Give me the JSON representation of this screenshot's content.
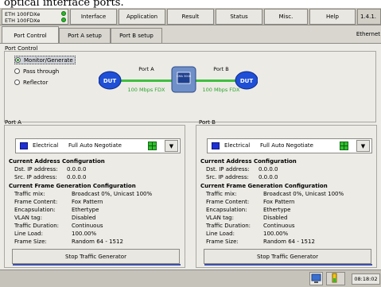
{
  "caption": "optical interface ports.",
  "module": {
    "line1": "ETH 100FDXe",
    "line2": "ETH 100FDXe"
  },
  "menu": [
    "Interface",
    "Application",
    "Result",
    "Status",
    "Misc.",
    "Help"
  ],
  "version": "1.4.1.",
  "tabs": [
    "Port Control",
    "Port A setup",
    "Port B setup"
  ],
  "section_label": "Ethernet",
  "port_control": {
    "title": "Port Control",
    "modes": [
      "Monitor/Generate",
      "Pass through",
      "Reflector"
    ],
    "selected_mode": "Monitor/Generate"
  },
  "diagram": {
    "dut_left": "DUT",
    "dut_right": "DUT",
    "port_a": "Port A",
    "port_b": "Port B",
    "speed_a": "100 Mbps FDX",
    "speed_b": "100 Mbps FDX",
    "device": "CMA 3000"
  },
  "labels": {
    "current_address": "Current Address Configuration",
    "dst_ip": "Dst. IP address:",
    "src_ip": "Src. IP address:",
    "current_frame": "Current Frame Generation Configuration",
    "traffic_mix": "Traffic mix:",
    "frame_content": "Frame Content:",
    "encapsulation": "Encapsulation:",
    "vlan_tag": "VLAN tag:",
    "traffic_duration": "Traffic Duration:",
    "line_load": "Line Load:",
    "frame_size": "Frame Size:"
  },
  "ports": [
    {
      "title": "Port A",
      "interface": "Electrical",
      "negotiation": "Full Auto Negotiate",
      "dst_ip": "0.0.0.0",
      "src_ip": "0.0.0.0",
      "traffic_mix": "Broadcast 0%, Unicast 100%",
      "frame_content": "Fox Pattern",
      "encapsulation": "Ethertype",
      "vlan_tag": "Disabled",
      "traffic_duration": "Continuous",
      "line_load": "100.00%",
      "frame_size": "Random 64 - 1512",
      "button": "Stop Traffic Generator"
    },
    {
      "title": "Port B",
      "interface": "Electrical",
      "negotiation": "Full Auto Negotiate",
      "dst_ip": "0.0.0.0",
      "src_ip": "0.0.0.0",
      "traffic_mix": "Broadcast 0%, Unicast 100%",
      "frame_content": "Fox Pattern",
      "encapsulation": "Ethertype",
      "vlan_tag": "Disabled",
      "traffic_duration": "Continuous",
      "line_load": "100.00%",
      "frame_size": "Random 64 - 1512",
      "button": "Stop Traffic Generator"
    }
  ],
  "status": {
    "time": "08:18:02"
  },
  "colors": {
    "accent_blue": "#1f2fd6",
    "led_green": "#29b829",
    "link_green": "#3fbf3f"
  }
}
